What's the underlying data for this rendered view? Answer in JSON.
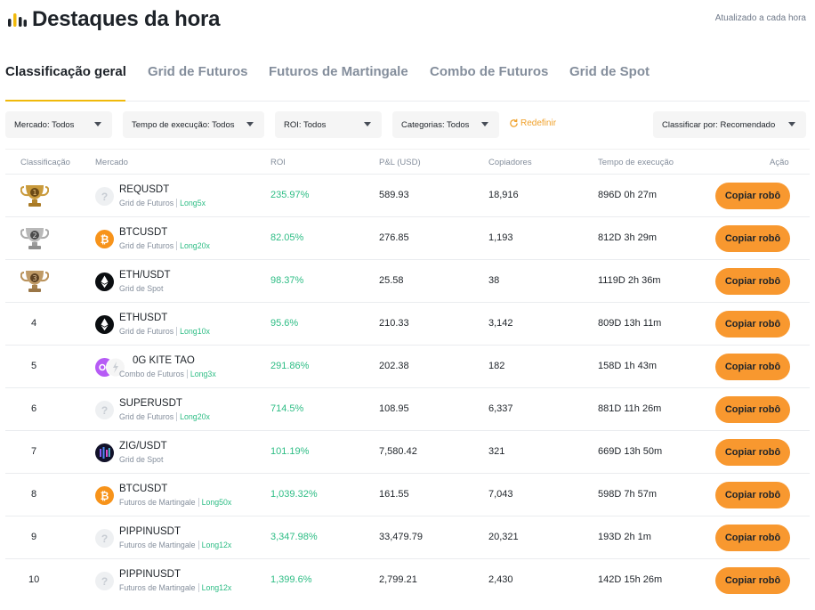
{
  "header": {
    "title": "Destaques da hora",
    "update_note": "Atualizado a cada hora",
    "logo_icon": "bar-chart-icon",
    "accent_color": "#f0b90b"
  },
  "tabs": [
    {
      "label": "Classificação geral",
      "active": true
    },
    {
      "label": "Grid de Futuros",
      "active": false
    },
    {
      "label": "Futuros de Martingale",
      "active": false
    },
    {
      "label": "Combo de Futuros",
      "active": false
    },
    {
      "label": "Grid de Spot",
      "active": false
    }
  ],
  "filters": {
    "market": "Mercado: Todos",
    "runtime": "Tempo de execução: Todos",
    "roi": "ROI: Todos",
    "categories": "Categorias: Todos",
    "reset": "Redefinir",
    "sort": "Classificar por: Recomendado"
  },
  "table": {
    "headers": {
      "rank": "Classificação",
      "market": "Mercado",
      "roi": "ROI",
      "pnl": "P&L (USD)",
      "copiers": "Copiadores",
      "runtime": "Tempo de execução",
      "action": "Ação"
    },
    "button_label": "Copiar robô",
    "rows": [
      {
        "rank": "1",
        "trophy": "gold",
        "coin": "placeholder-coin-icon",
        "symbol": "REQUSDT",
        "strategy": "Grid de Futuros",
        "leverage": "Long5x",
        "roi": "235.97%",
        "pnl": "589.93",
        "copiers": "18,916",
        "runtime": "896D 0h 27m"
      },
      {
        "rank": "2",
        "trophy": "silver",
        "coin": "btc-icon",
        "symbol": "BTCUSDT",
        "strategy": "Grid de Futuros",
        "leverage": "Long20x",
        "roi": "82.05%",
        "pnl": "276.85",
        "copiers": "1,193",
        "runtime": "812D 3h 29m"
      },
      {
        "rank": "3",
        "trophy": "bronze",
        "coin": "eth-icon",
        "symbol": "ETH/USDT",
        "strategy": "Grid de Spot",
        "leverage": "",
        "roi": "98.37%",
        "pnl": "25.58",
        "copiers": "38",
        "runtime": "1119D 2h 36m"
      },
      {
        "rank": "4",
        "trophy": "",
        "coin": "eth-icon",
        "symbol": "ETHUSDT",
        "strategy": "Grid de Futuros",
        "leverage": "Long10x",
        "roi": "95.6%",
        "pnl": "210.33",
        "copiers": "3,142",
        "runtime": "809D 13h 11m"
      },
      {
        "rank": "5",
        "trophy": "",
        "coin": "combo-coins-icon",
        "symbol": "0G KITE TAO",
        "strategy": "Combo de Futuros",
        "leverage": "Long3x",
        "roi": "291.86%",
        "pnl": "202.38",
        "copiers": "182",
        "runtime": "158D 1h 43m"
      },
      {
        "rank": "6",
        "trophy": "",
        "coin": "placeholder-coin-icon",
        "symbol": "SUPERUSDT",
        "strategy": "Grid de Futuros",
        "leverage": "Long20x",
        "roi": "714.5%",
        "pnl": "108.95",
        "copiers": "6,337",
        "runtime": "881D 11h 26m"
      },
      {
        "rank": "7",
        "trophy": "",
        "coin": "zig-icon",
        "symbol": "ZIG/USDT",
        "strategy": "Grid de Spot",
        "leverage": "",
        "roi": "101.19%",
        "pnl": "7,580.42",
        "copiers": "321",
        "runtime": "669D 13h 50m"
      },
      {
        "rank": "8",
        "trophy": "",
        "coin": "btc-icon",
        "symbol": "BTCUSDT",
        "strategy": "Futuros de Martingale",
        "leverage": "Long50x",
        "roi": "1,039.32%",
        "pnl": "161.55",
        "copiers": "7,043",
        "runtime": "598D 7h 57m"
      },
      {
        "rank": "9",
        "trophy": "",
        "coin": "placeholder-coin-icon",
        "symbol": "PIPPINUSDT",
        "strategy": "Futuros de Martingale",
        "leverage": "Long12x",
        "roi": "3,347.98%",
        "pnl": "33,479.79",
        "copiers": "20,321",
        "runtime": "193D 2h 1m"
      },
      {
        "rank": "10",
        "trophy": "",
        "coin": "placeholder-coin-icon",
        "symbol": "PIPPINUSDT",
        "strategy": "Futuros de Martingale",
        "leverage": "Long12x",
        "roi": "1,399.6%",
        "pnl": "2,799.21",
        "copiers": "2,430",
        "runtime": "142D 15h 26m"
      }
    ]
  },
  "colors": {
    "roi_positive": "#2ebd85",
    "button": "#f8982f",
    "reset_link": "#f0a12b",
    "gold": "#c99a3b",
    "silver": "#a9a9a9",
    "bronze": "#b89058"
  }
}
